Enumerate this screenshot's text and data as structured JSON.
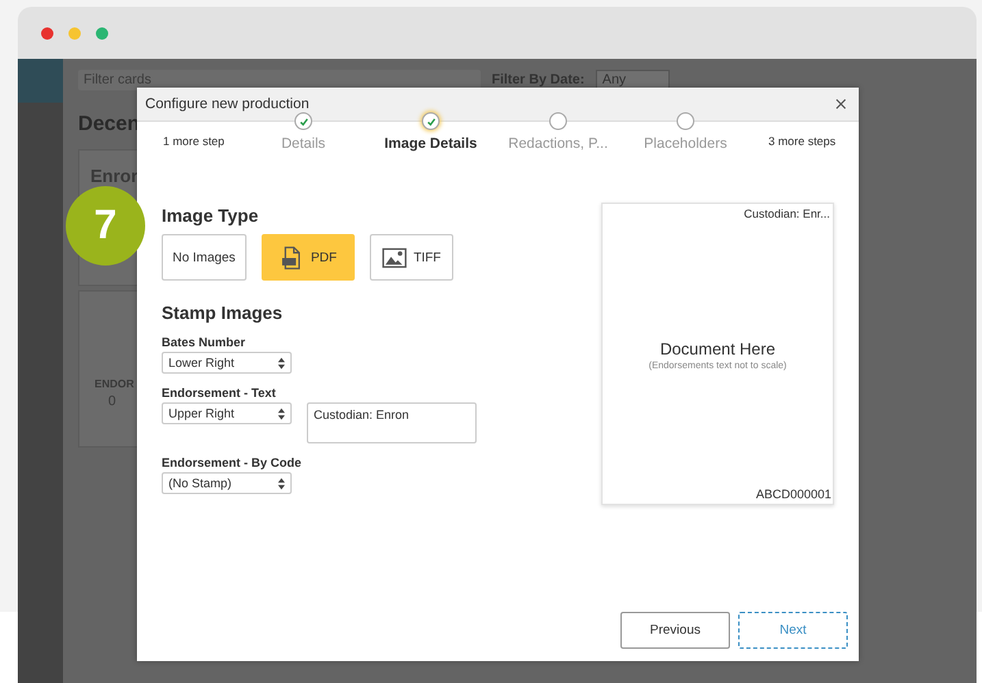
{
  "background_app": {
    "filter_placeholder": "Filter cards",
    "date_filter_label": "Filter By Date:",
    "date_filter_value": "Any",
    "heading": "Decen",
    "card_title": "Enror",
    "card_label": "ENDOR",
    "card_value": "0"
  },
  "step_badge": "7",
  "modal": {
    "title": "Configure new production",
    "steps_before": "1 more step",
    "steps": [
      {
        "label": "Details",
        "done": true,
        "selected": false
      },
      {
        "label": "Image Details",
        "done": true,
        "selected": true
      },
      {
        "label": "Redactions, P...",
        "done": false,
        "selected": false
      },
      {
        "label": "Placeholders",
        "done": false,
        "selected": false
      }
    ],
    "steps_after": "3 more steps",
    "image_type_heading": "Image Type",
    "image_types": [
      {
        "label": "No Images",
        "kind": "none",
        "selected": false
      },
      {
        "label": "PDF",
        "kind": "pdf",
        "selected": true
      },
      {
        "label": "TIFF",
        "kind": "tiff",
        "selected": false
      }
    ],
    "stamp_heading": "Stamp Images",
    "fields": [
      {
        "label": "Bates Number",
        "value": "Lower Right"
      },
      {
        "label": "Endorsement - Text",
        "value": "Upper Right",
        "text": "Custodian: Enron"
      },
      {
        "label": "Endorsement - By Code",
        "value": "(No Stamp)"
      }
    ],
    "preview": {
      "top_text": "Custodian: Enr...",
      "title": "Document Here",
      "note": "(Endorsements text not to scale)",
      "bottom_text": "ABCD000001"
    },
    "buttons": [
      {
        "label": "Previous",
        "kind": "secondary"
      },
      {
        "label": "Next",
        "kind": "primary"
      }
    ]
  }
}
